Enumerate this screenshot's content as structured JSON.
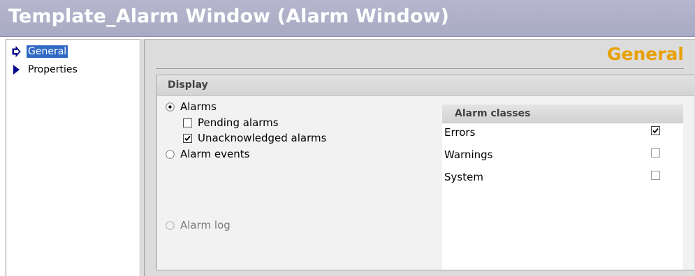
{
  "window": {
    "title": "Template_Alarm Window (Alarm Window)"
  },
  "nav": {
    "items": [
      {
        "label": "General",
        "selected": true,
        "icon": "arrow-right-outline-icon"
      },
      {
        "label": "Properties",
        "selected": false,
        "icon": "arrow-right-solid-icon"
      }
    ]
  },
  "main": {
    "section_title": "General",
    "display": {
      "title": "Display",
      "options": [
        {
          "label": "Alarms",
          "type": "radio",
          "checked": true
        },
        {
          "label": "Pending alarms",
          "type": "checkbox",
          "checked": false
        },
        {
          "label": "Unacknowledged alarms",
          "type": "checkbox",
          "checked": true
        },
        {
          "label": "Alarm events",
          "type": "radio",
          "checked": false
        },
        {
          "label": "Alarm log",
          "type": "radio",
          "checked": false,
          "disabled": true
        }
      ]
    },
    "alarm_classes": {
      "title": "Alarm classes",
      "items": [
        {
          "name": "Errors",
          "checked": true
        },
        {
          "name": "Warnings",
          "checked": false
        },
        {
          "name": "System",
          "checked": false
        }
      ]
    }
  },
  "colors": {
    "title_bar": "#b1b2ca",
    "accent_orange": "#e8a000",
    "selection": "#316ac5",
    "nav_arrow": "#0a0a8c"
  }
}
